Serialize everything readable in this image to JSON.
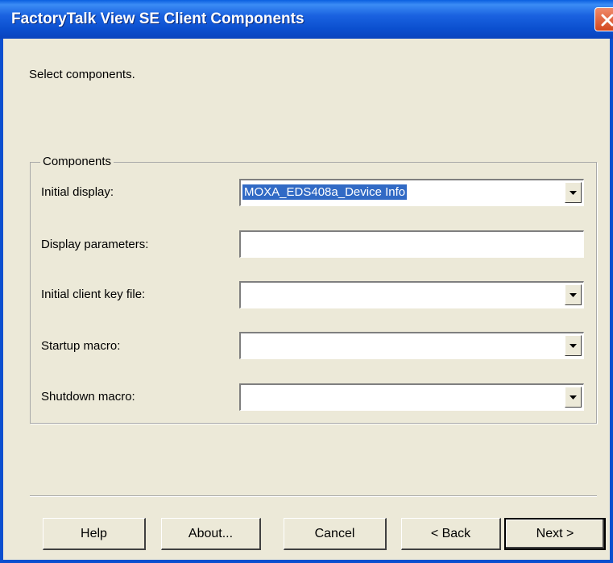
{
  "window": {
    "title": "FactoryTalk View SE Client Components"
  },
  "instruction": "Select components.",
  "components": {
    "legend": "Components",
    "initial_display": {
      "label": "Initial display:",
      "value": "MOXA_EDS408a_Device Info"
    },
    "display_parameters": {
      "label": "Display parameters:",
      "value": ""
    },
    "initial_client_key_file": {
      "label": "Initial client key file:",
      "value": ""
    },
    "startup_macro": {
      "label": "Startup macro:",
      "value": ""
    },
    "shutdown_macro": {
      "label": "Shutdown macro:",
      "value": ""
    }
  },
  "buttons": {
    "help": "Help",
    "about": "About...",
    "cancel": "Cancel",
    "back": "< Back",
    "next": "Next >"
  },
  "icons": {
    "close": "close-icon",
    "dropdown": "chevron-down-icon"
  },
  "colors": {
    "title_bar": "#0b4fcf",
    "dialog_bg": "#ece9d8",
    "selection": "#316ac5"
  }
}
